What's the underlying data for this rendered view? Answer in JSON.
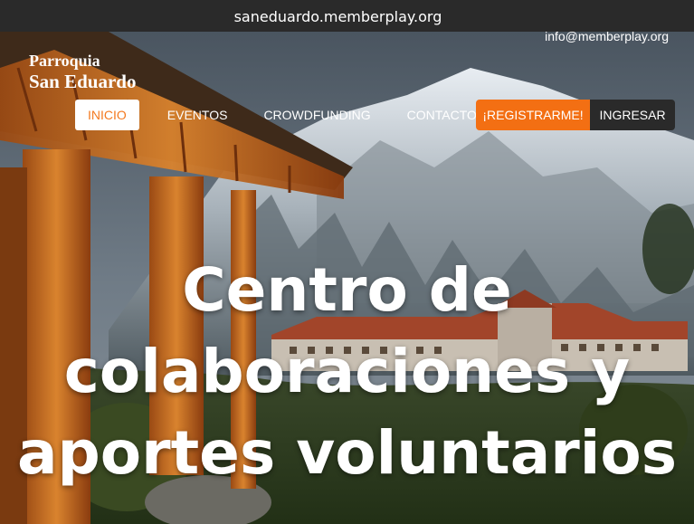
{
  "top_bar": {
    "url": "saneduardo.memberplay.org"
  },
  "header": {
    "email": "info@memberplay.org",
    "logo": {
      "line1": "Parroquia",
      "line2": "San Eduardo"
    }
  },
  "nav": {
    "items": [
      {
        "label": "INICIO",
        "active": true
      },
      {
        "label": "EVENTOS"
      },
      {
        "label": "CROWDFUNDING"
      },
      {
        "label": "CONTACTO"
      }
    ],
    "register_label": "¡REGISTRARME!",
    "login_label": "INGRESAR"
  },
  "hero": {
    "headline_lines": [
      "Centro de",
      "colaboraciones y",
      "aportes voluntarios"
    ]
  },
  "colors": {
    "accent_orange": "#f36f13",
    "active_text": "#f47a20",
    "dark_bar": "#2a2a2a"
  }
}
